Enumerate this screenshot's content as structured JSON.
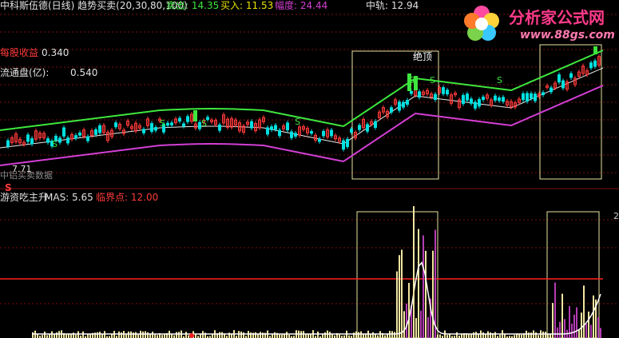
{
  "header": {
    "title": "中科斯伍德(日线) 趋势买卖(20,30,80,100)",
    "sell_label": "卖出: 14.35",
    "buy_label": "买入: 11.53",
    "range_label": "幅度: 24.44",
    "mid_label": "中轨: 12.94"
  },
  "info": {
    "eps_label": "每股收益",
    "eps_value": "0.340",
    "float_label": "流通盘(亿):",
    "float_value": "0.540"
  },
  "annotations": {
    "top_marker": "绝顶",
    "s_marker": "S",
    "b_marker": "S",
    "price_low": "7.71",
    "watermark": "中铝买卖数据"
  },
  "sub_indicator": {
    "name": "游资吃主升",
    "mas_label": "MAS: 5.65",
    "threshold_label": "临界点: 12.00",
    "axis_tick": "2"
  },
  "logo": {
    "title": "分析家公式网",
    "url": "www.88gs.com"
  },
  "colors": {
    "bg": "#000000",
    "upper_band": "#3ee53e",
    "lower_band": "#d23fd2",
    "middle": "#e8e8e8",
    "up_candle": "#ff3a3a",
    "down_candle": "#00e0e0",
    "box": "#e8e4a0",
    "threshold": "#ff2020",
    "volume": "#b43cb4",
    "volume_alt": "#f2e6a0"
  }
}
